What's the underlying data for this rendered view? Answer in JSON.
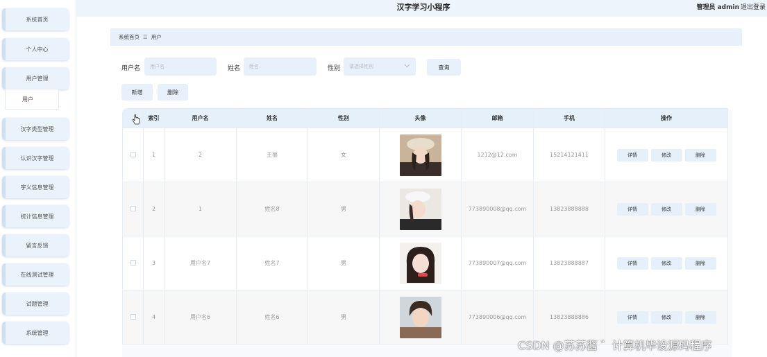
{
  "app": {
    "title": "汉字学习小程序",
    "admin_label": "管理员 admin",
    "logout": "退出登录"
  },
  "sidebar": {
    "items": [
      {
        "label": "系统首页"
      },
      {
        "label": "个人中心"
      },
      {
        "label": "用户管理"
      },
      {
        "label": "汉字类型管理"
      },
      {
        "label": "认识汉字管理"
      },
      {
        "label": "字义信息管理"
      },
      {
        "label": "统计信息管理"
      },
      {
        "label": "留言反馈"
      },
      {
        "label": "在线测试管理"
      },
      {
        "label": "试题管理"
      },
      {
        "label": "系统管理"
      }
    ],
    "sub_item": {
      "label": "用户"
    }
  },
  "breadcrumb": {
    "home": "系统首页",
    "separator": "☰",
    "current": "用户"
  },
  "search": {
    "username_label": "用户名",
    "username_placeholder": "用户名",
    "name_label": "姓名",
    "name_placeholder": "姓名",
    "gender_label": "性别",
    "gender_placeholder": "请选择性别",
    "query_button": "查询"
  },
  "actions": {
    "add_button": "新增",
    "delete_button": "删除"
  },
  "table": {
    "headers": [
      "",
      "索引",
      "用户名",
      "姓名",
      "性别",
      "头像",
      "邮箱",
      "手机",
      "操作"
    ],
    "rows": [
      {
        "index": "1",
        "username": "2",
        "name": "王丽",
        "gender": "女",
        "email": "1212@12.com",
        "phone": "15214121411"
      },
      {
        "index": "2",
        "username": "1",
        "name": "姓名8",
        "gender": "男",
        "email": "773890008@qq.com",
        "phone": "13823888888"
      },
      {
        "index": "3",
        "username": "用户名7",
        "name": "姓名7",
        "gender": "男",
        "email": "773890007@qq.com",
        "phone": "13823888887"
      },
      {
        "index": "4",
        "username": "用户名6",
        "name": "姓名6",
        "gender": "男",
        "email": "773890006@qq.com",
        "phone": "13823888886"
      }
    ],
    "op_buttons": {
      "detail": "详情",
      "edit": "修改",
      "delete": "删除"
    }
  },
  "watermark": "CSDN @苏苏酱 ゛计算机毕设源码程序",
  "colors": {
    "accent": "#e8f1fb",
    "header_bg": "#edf4fb",
    "sidebar_button": "#eaf3fc"
  }
}
